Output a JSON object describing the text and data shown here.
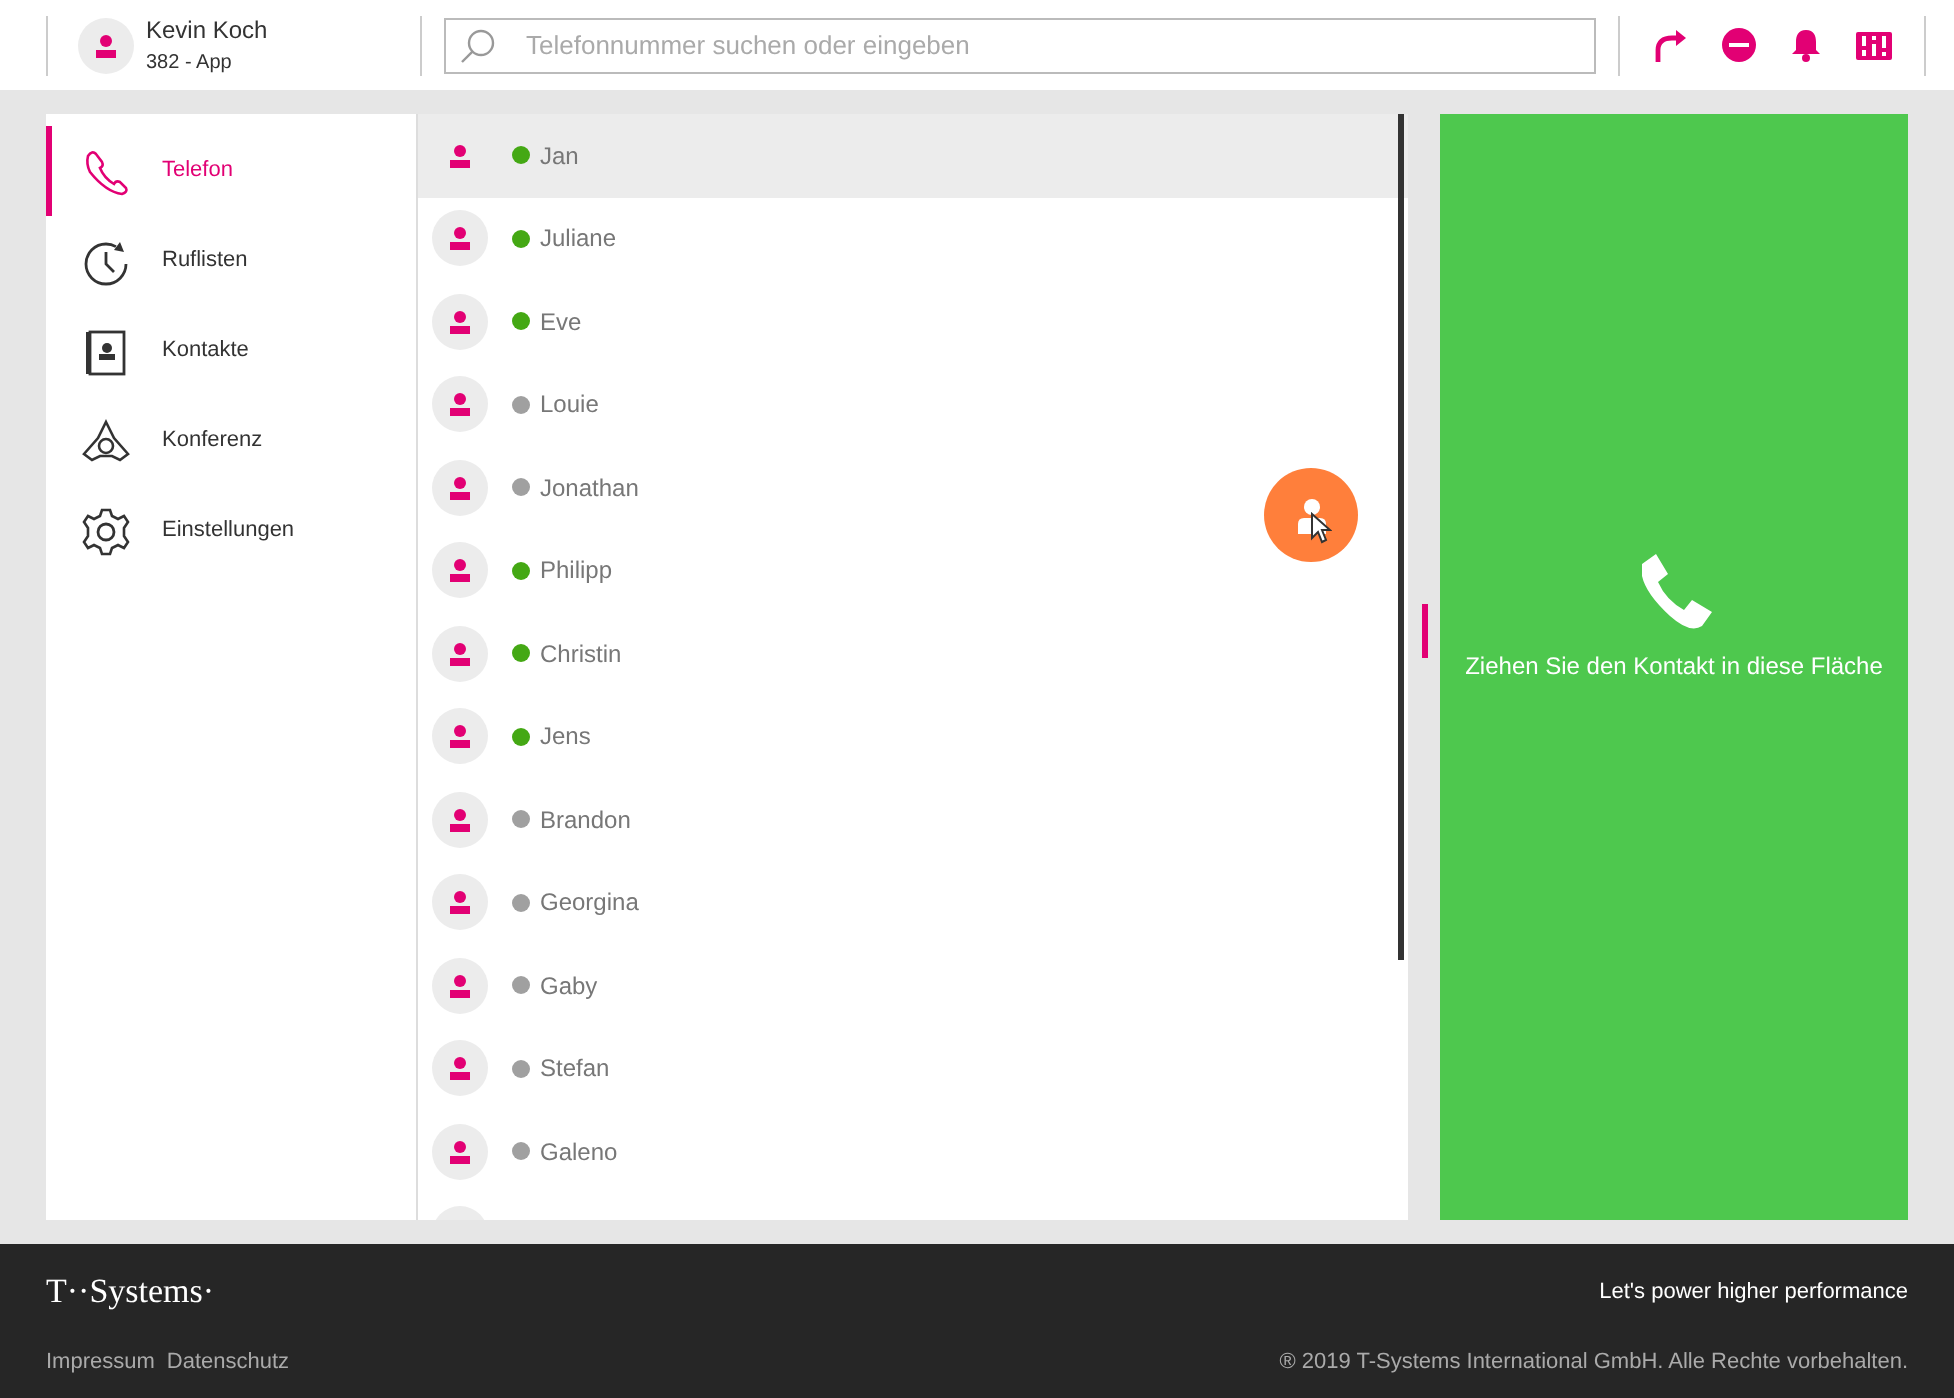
{
  "user": {
    "name": "Kevin Koch",
    "line": "382 - App"
  },
  "search": {
    "placeholder": "Telefonnummer suchen oder eingeben"
  },
  "nav": [
    {
      "label": "Telefon",
      "kind": "phone",
      "selected": true
    },
    {
      "label": "Ruflisten",
      "kind": "history",
      "selected": false
    },
    {
      "label": "Kontakte",
      "kind": "contacts",
      "selected": false
    },
    {
      "label": "Konferenz",
      "kind": "conference",
      "selected": false
    },
    {
      "label": "Einstellungen",
      "kind": "settings",
      "selected": false
    }
  ],
  "contacts": [
    {
      "kind": "contact",
      "name": "Jan",
      "online": true,
      "selected": true
    },
    {
      "kind": "contact",
      "name": "Juliane",
      "online": true,
      "selected": false
    },
    {
      "kind": "contact",
      "name": "Eve",
      "online": true,
      "selected": false
    },
    {
      "kind": "contact",
      "name": "Louie",
      "online": false,
      "selected": false
    },
    {
      "kind": "contact",
      "name": "Jonathan",
      "online": false,
      "selected": false
    },
    {
      "kind": "contact",
      "name": "Philipp",
      "online": true,
      "selected": false
    },
    {
      "kind": "contact",
      "name": "Christin",
      "online": true,
      "selected": false
    },
    {
      "kind": "contact",
      "name": "Jens",
      "online": true,
      "selected": false
    },
    {
      "kind": "contact",
      "name": "Brandon",
      "online": false,
      "selected": false
    },
    {
      "kind": "contact",
      "name": "Georgina",
      "online": false,
      "selected": false
    },
    {
      "kind": "contact",
      "name": "Gaby",
      "online": false,
      "selected": false
    },
    {
      "kind": "contact",
      "name": "Stefan",
      "online": false,
      "selected": false
    },
    {
      "kind": "contact",
      "name": "Galeno",
      "online": false,
      "selected": false
    },
    {
      "kind": "partial"
    }
  ],
  "drop_zone": {
    "text": "Ziehen Sie den Kontakt in diese Fläche"
  },
  "footer": {
    "logo": "T··Systems·",
    "slogan": "Let's power higher performance",
    "links": [
      "Impressum",
      "Datenschutz"
    ],
    "copyright": "® 2019 T-Systems International GmbH. Alle Rechte vorbehalten."
  }
}
